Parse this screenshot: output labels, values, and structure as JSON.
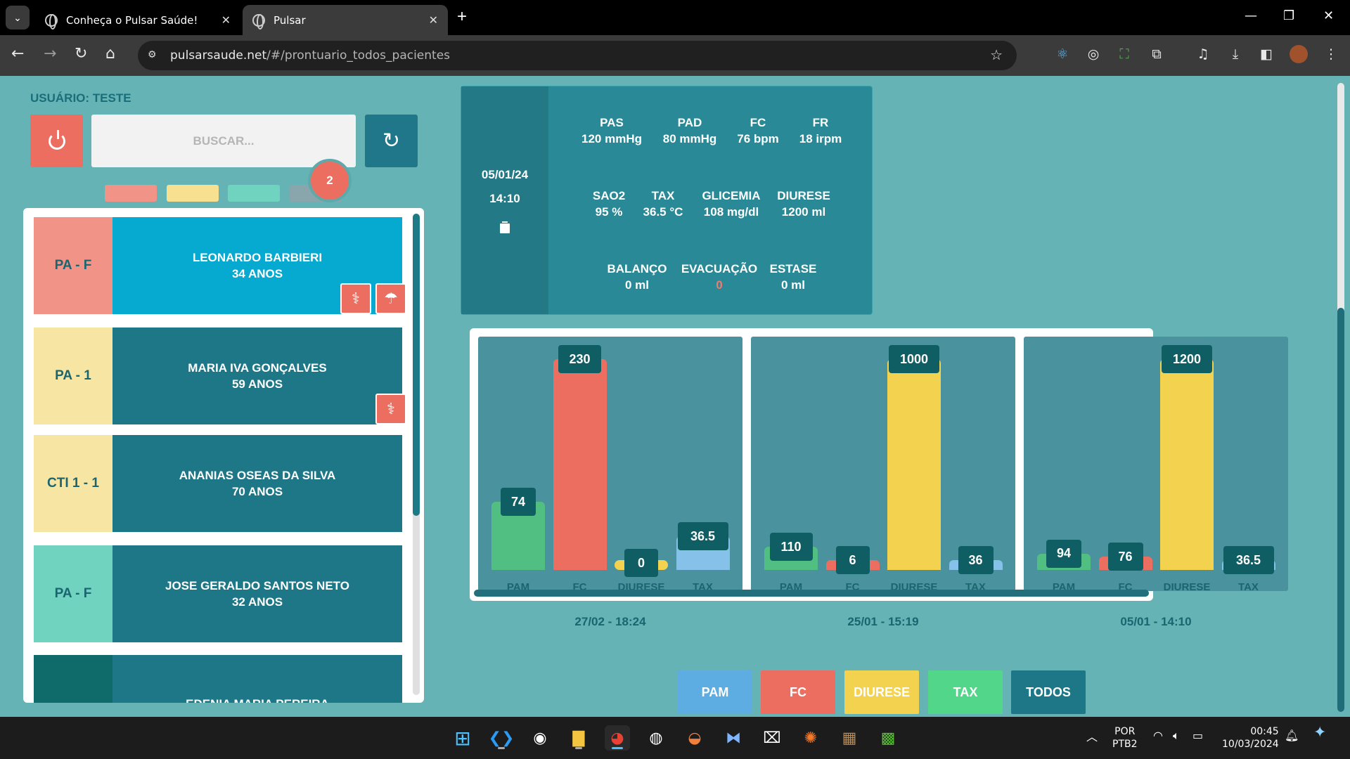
{
  "browser": {
    "tabs": [
      {
        "title": "Conheça o Pulsar Saúde!"
      },
      {
        "title": "Pulsar"
      }
    ],
    "url_host": "pulsarsaude.net",
    "url_path": "/#/prontuario_todos_pacientes"
  },
  "sidebar": {
    "user_label": "USUÁRIO: TESTE",
    "search_placeholder": "BUSCAR...",
    "badge_count": "2",
    "filter_colors": [
      "#f29387",
      "#f7e08f",
      "#6fd3bf",
      "#8aa6ad"
    ],
    "patients": [
      {
        "location": "PA - F",
        "name": "LEONARDO BARBIERI",
        "age": "34 ANOS",
        "loc_color": "#f29387",
        "info_color": "#06a9cf",
        "icons": [
          "stethoscope-icon",
          "hand-wash-icon"
        ]
      },
      {
        "location": "PA - 1",
        "name": "MARIA IVA GONÇALVES",
        "age": "59 ANOS",
        "loc_color": "#f7e5a3",
        "info_color": "#1d7787",
        "icons": [
          "stethoscope-icon"
        ]
      },
      {
        "location": "CTI 1 - 1",
        "name": "ANANIAS OSEAS DA SILVA",
        "age": "70 ANOS",
        "loc_color": "#f7e5a3",
        "info_color": "#1d7787",
        "icons": []
      },
      {
        "location": "PA - F",
        "name": "JOSE GERALDO SANTOS NETO",
        "age": "32 ANOS",
        "loc_color": "#6fd3bf",
        "info_color": "#1d7787",
        "icons": []
      },
      {
        "location": "",
        "name": "EDENIA MARIA PEREIRA",
        "age": "",
        "loc_color": "#0f6b6a",
        "info_color": "#1d7787",
        "icons": []
      }
    ]
  },
  "vitals": {
    "date": "05/01/24",
    "time": "14:10",
    "rows": [
      [
        {
          "label": "PAS",
          "value": "120 mmHg"
        },
        {
          "label": "PAD",
          "value": "80 mmHg"
        },
        {
          "label": "FC",
          "value": "76 bpm"
        },
        {
          "label": "FR",
          "value": "18 irpm"
        }
      ],
      [
        {
          "label": "SAO2",
          "value": "95 %"
        },
        {
          "label": "TAX",
          "value": "36.5 °C"
        },
        {
          "label": "GLICEMIA",
          "value": "108 mg/dl"
        },
        {
          "label": "DIURESE",
          "value": "1200 ml"
        }
      ],
      [
        {
          "label": "BALANÇO",
          "value": "0 ml"
        },
        {
          "label": "EVACUAÇÃO",
          "value": "0"
        },
        {
          "label": "ESTASE",
          "value": "0 ml"
        }
      ]
    ]
  },
  "chart_data": {
    "type": "bar",
    "categories": [
      "PAM",
      "FC",
      "DIURESE",
      "TAX"
    ],
    "series_colors": {
      "PAM": "#52bf82",
      "FC": "#ec6e60",
      "DIURESE": "#f2d24f",
      "TAX": "#85c1e9"
    },
    "panels": [
      {
        "title": "27/02 - 18:24",
        "values": [
          74,
          230,
          0,
          36.5
        ],
        "labels": [
          "74",
          "230",
          "0",
          "36.5"
        ]
      },
      {
        "title": "25/01 - 15:19",
        "values": [
          110,
          6,
          1000,
          36
        ],
        "labels": [
          "110",
          "6",
          "1000",
          "36"
        ]
      },
      {
        "title": "05/01 - 14:10",
        "values": [
          94,
          76,
          1200,
          36.5
        ],
        "labels": [
          "94",
          "76",
          "1200",
          "36.5"
        ]
      }
    ]
  },
  "bottom_buttons": [
    {
      "label": "PAM",
      "color": "#5dade2"
    },
    {
      "label": "FC",
      "color": "#ec6e60"
    },
    {
      "label": "DIURESE",
      "color": "#f2d24f"
    },
    {
      "label": "TAX",
      "color": "#52d68a"
    },
    {
      "label": "TODOS",
      "color": "#1d7787"
    }
  ],
  "taskbar": {
    "language": "POR",
    "layout": "PTB2",
    "time": "00:45",
    "date": "10/03/2024"
  }
}
